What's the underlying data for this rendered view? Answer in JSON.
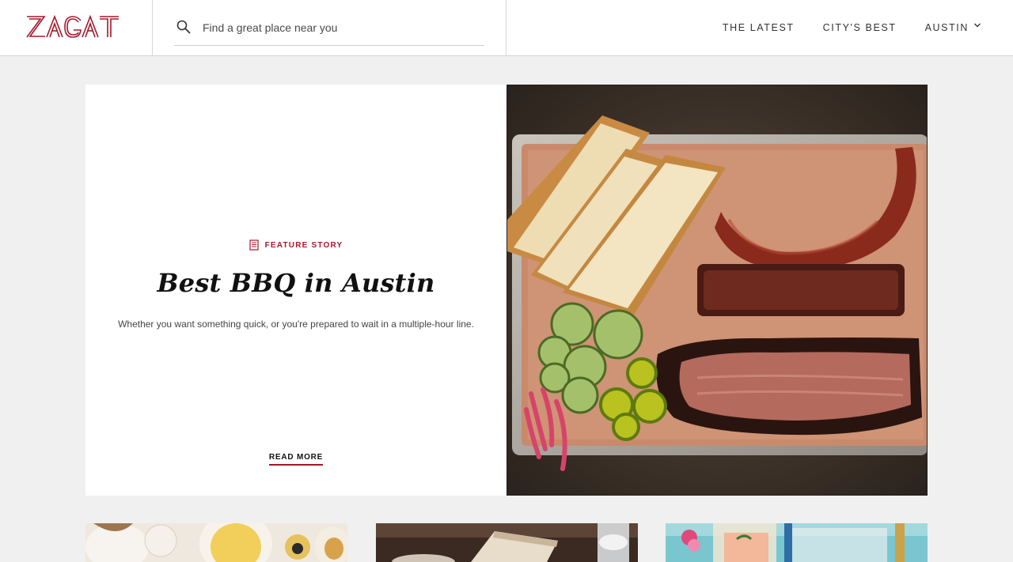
{
  "brand": {
    "logo_text": "ZAGAT",
    "accent": "#a3182a"
  },
  "search": {
    "placeholder": "Find a great place near you",
    "value": ""
  },
  "nav": {
    "items": [
      "THE LATEST",
      "CITY'S BEST",
      "AUSTIN"
    ]
  },
  "hero": {
    "kicker_icon": "newspaper-icon",
    "kicker": "FEATURE STORY",
    "title": "Best BBQ in Austin",
    "dek": "Whether you want something quick, or you're prepared to wait in a multiple-hour line.",
    "cta": "READ MORE"
  },
  "icons": {
    "search": "search-icon",
    "dropdown": "chevron-down-icon"
  }
}
